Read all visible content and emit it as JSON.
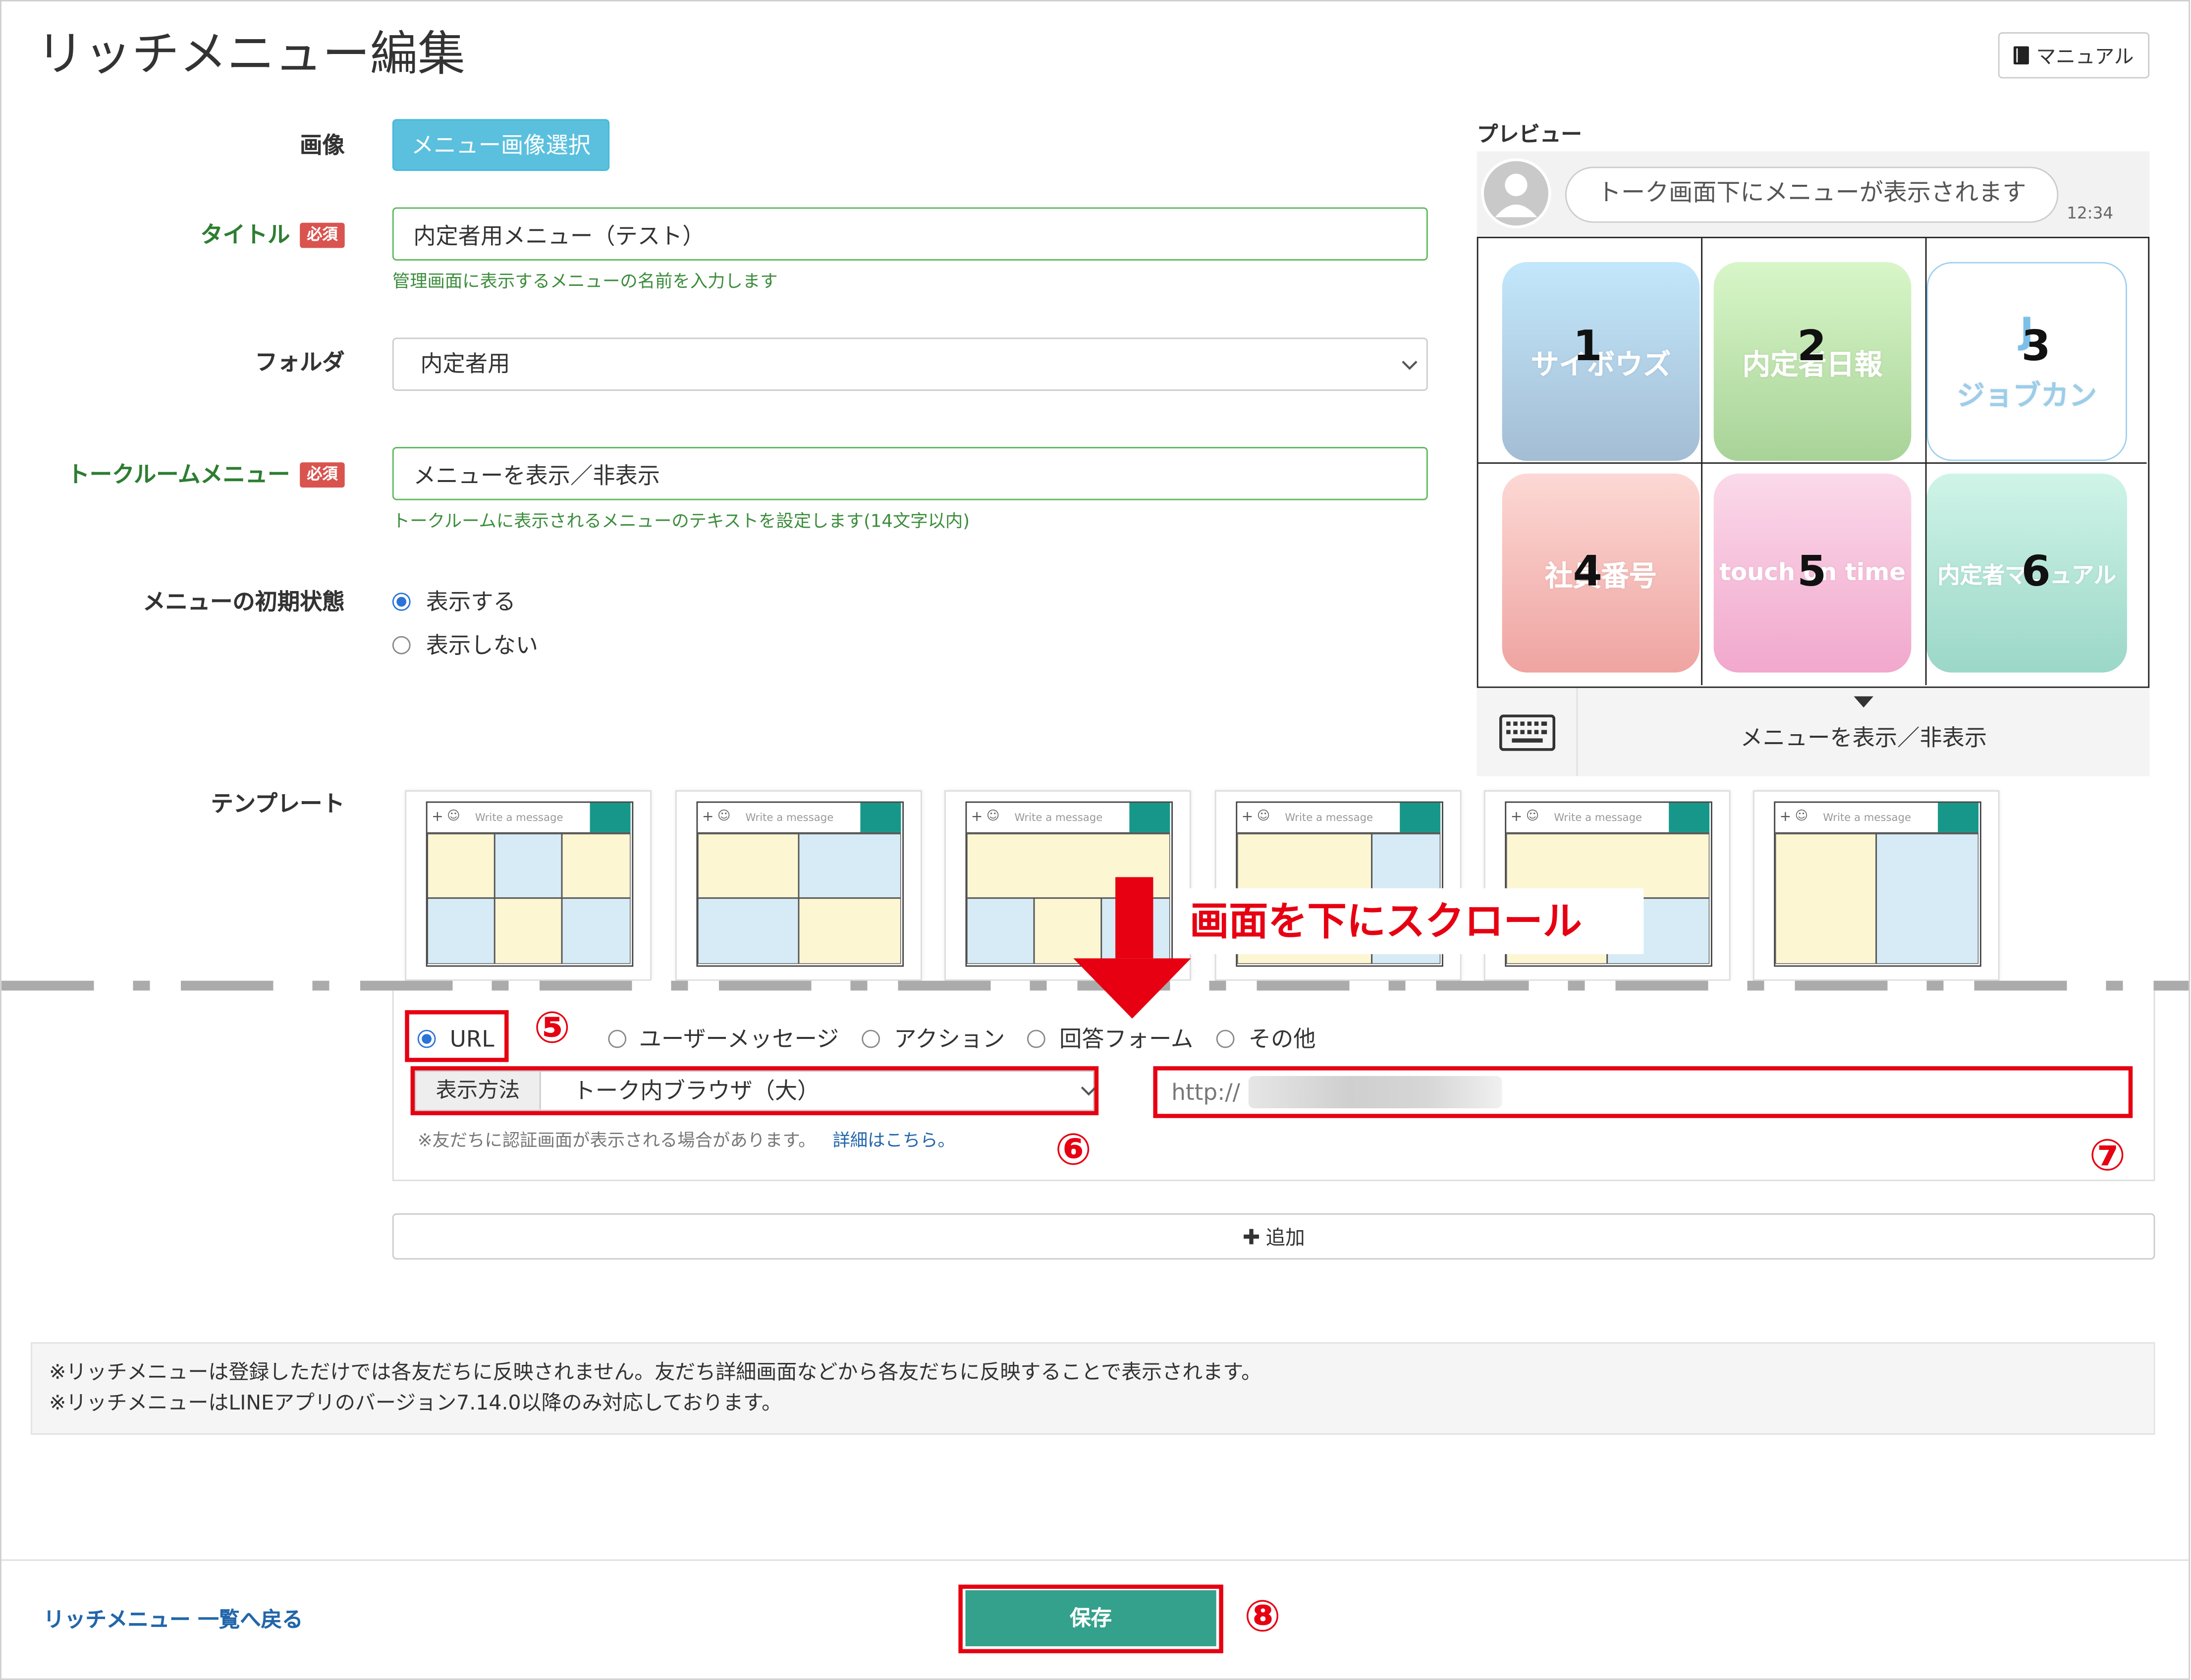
{
  "page": {
    "title": "リッチメニュー編集",
    "manual_label": "マニュアル"
  },
  "form": {
    "image": {
      "label": "画像",
      "button": "メニュー画像選択"
    },
    "title": {
      "label": "タイトル",
      "required": "必須",
      "value": "内定者用メニュー（テスト）",
      "help": "管理画面に表示するメニューの名前を入力します"
    },
    "folder": {
      "label": "フォルダ",
      "value": "内定者用"
    },
    "talkroom": {
      "label": "トークルームメニュー",
      "required": "必須",
      "value": "メニューを表示／非表示",
      "help": "トークルームに表示されるメニューのテキストを設定します(14文字以内)"
    },
    "initial": {
      "label": "メニューの初期状態",
      "options": [
        "表示する",
        "表示しない"
      ],
      "selected_index": 0
    },
    "template": {
      "label": "テンプレート",
      "placeholder": "Write a message"
    }
  },
  "preview": {
    "label": "プレビュー",
    "bubble": "トーク画面下にメニューが表示されます",
    "time": "12:34",
    "tiles": [
      {
        "number": "1",
        "label": "サイボウズ"
      },
      {
        "number": "2",
        "label": "内定者日報"
      },
      {
        "number": "3",
        "logo": "J",
        "label": "ジョブカン"
      },
      {
        "number": "4",
        "label": "社員番号"
      },
      {
        "number": "5",
        "label": "touch on time"
      },
      {
        "number": "6",
        "label": "内定者マニュアル"
      }
    ],
    "bar_text": "メニューを表示／非表示"
  },
  "annotation": {
    "scroll_text": "画面を下にスクロール",
    "mark5": "⑤",
    "mark6": "⑥",
    "mark7": "⑦",
    "mark8": "⑧"
  },
  "action": {
    "types": [
      "URL",
      "ユーザーメッセージ",
      "アクション",
      "回答フォーム",
      "その他"
    ],
    "selected_index": 0,
    "display_label": "表示方法",
    "display_value": "トーク内ブラウザ（大）",
    "url_value": "http://",
    "note": "※友だちに認証画面が表示される場合があります。",
    "note_link": "詳細はこちら。"
  },
  "add_label": "追加",
  "notice": [
    "※リッチメニューは登録しただけでは各友だちに反映されません。友だち詳細画面などから各友だちに反映することで表示されます。",
    "※リッチメニューはLINEアプリのバージョン7.14.0以降のみ対応しております。"
  ],
  "footer": {
    "back_link": "リッチメニュー 一覧へ戻る",
    "save": "保存"
  },
  "colors": {
    "primary_button": "#5bc0de",
    "required_badge": "#d9534f",
    "label_green": "#2e7d32",
    "annotation_red": "#e60012",
    "save_button": "#33a18c",
    "link_blue": "#2266aa"
  },
  "icons": {
    "manual": "book-icon",
    "avatar": "person-icon",
    "keyboard": "keyboard-icon",
    "dropdown": "chevron-down-icon",
    "add": "plus-icon",
    "scroll": "arrow-down-icon"
  }
}
